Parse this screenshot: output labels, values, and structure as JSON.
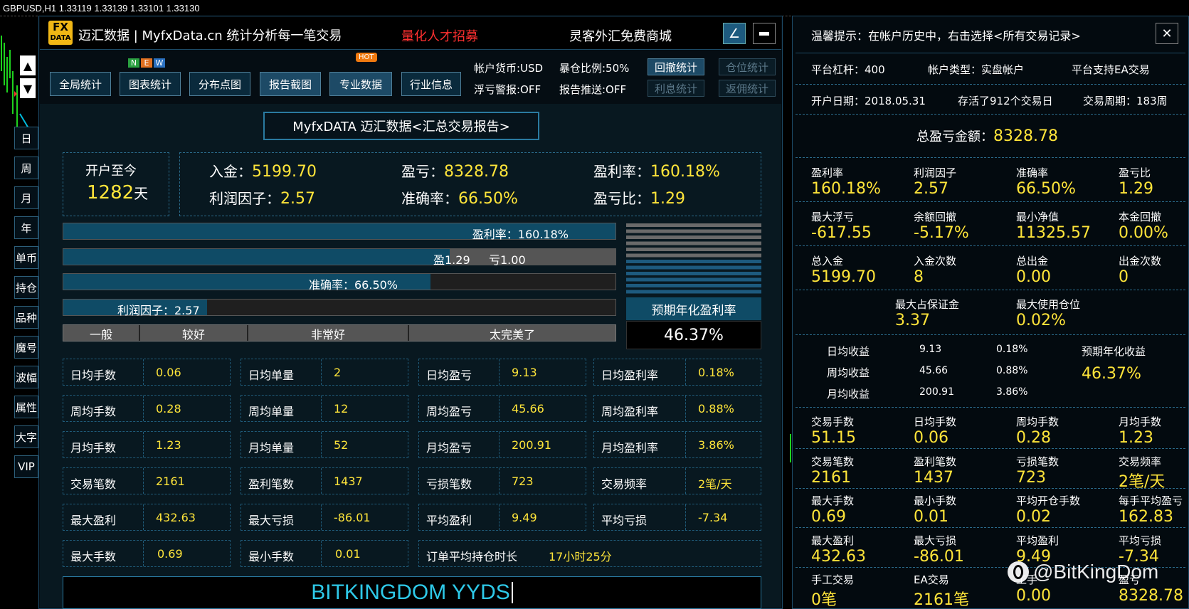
{
  "chart_title": "GBPUSD,H1  1.33119 1.33139 1.33101 1.33130",
  "header": {
    "logo_top": "FX",
    "logo_bottom": "DATA",
    "brand": "迈汇数据 | MyfxData.cn  统计分析每一笔交易",
    "recruit": "量化人才招募",
    "mall": "灵客外汇免费商城",
    "btn_arrow": "∠",
    "btn_min": "▬"
  },
  "toolbar": {
    "tabs": [
      "全局统计",
      "图表统计",
      "分布点图",
      "报告截图",
      "专业数据",
      "行业信息"
    ],
    "new_badge": [
      "N",
      "E",
      "W"
    ],
    "hot_badge": "HOT",
    "account_currency": "帐户货币:USD",
    "position_ratio": "暴仓比例:50%",
    "float_alert": "浮亏警报:OFF",
    "report_push": "报告推送:OFF",
    "right_buttons": [
      "回撤统计",
      "仓位统计",
      "利息统计",
      "返佣统计"
    ]
  },
  "side_buttons": [
    "日",
    "周",
    "月",
    "年",
    "单币",
    "持仓",
    "品种",
    "魔号",
    "波幅",
    "属性",
    "大字",
    "VIP"
  ],
  "report": {
    "title": "MyfxDATA 迈汇数据<汇总交易报告>",
    "since_label": "开户至今",
    "days_value": "1282",
    "days_unit": "天",
    "deposit_label": "入金：",
    "deposit": "5199.70",
    "profit_label": "盈亏：",
    "profit": "8328.78",
    "roi_label": "盈利率：",
    "roi": "160.18%",
    "pf_label": "利润因子：",
    "pf": "2.57",
    "accuracy_label": "准确率：",
    "accuracy": "66.50%",
    "ratio_label": "盈亏比：",
    "ratio": "1.29"
  },
  "bars": {
    "roi_text": "盈利率：160.18%",
    "roi_fill": 1.0,
    "win_text": "盈1.29",
    "loss_text": "亏1.00",
    "win_fill": 0.7,
    "accuracy_text": "准确率：66.50%",
    "accuracy_fill": 0.665,
    "pf_text": "利润因子：2.57",
    "pf_fill": 0.26,
    "scale": [
      "一般",
      "较好",
      "非常好",
      "太完美了"
    ],
    "annual_label": "预期年化盈利率",
    "annual_value": "46.37%"
  },
  "stats": [
    [
      [
        "日均手数",
        "0.06"
      ],
      [
        "日均单量",
        "2"
      ],
      [
        "日均盈亏",
        "9.13"
      ],
      [
        "日均盈利率",
        "0.18%"
      ]
    ],
    [
      [
        "周均手数",
        "0.28"
      ],
      [
        "周均单量",
        "12"
      ],
      [
        "周均盈亏",
        "45.66"
      ],
      [
        "周均盈利率",
        "0.88%"
      ]
    ],
    [
      [
        "月均手数",
        "1.23"
      ],
      [
        "月均单量",
        "52"
      ],
      [
        "月均盈亏",
        "200.91"
      ],
      [
        "月均盈利率",
        "3.86%"
      ]
    ],
    [
      [
        "交易笔数",
        "2161"
      ],
      [
        "盈利笔数",
        "1437"
      ],
      [
        "亏损笔数",
        "723"
      ],
      [
        "交易频率",
        "2笔/天"
      ]
    ],
    [
      [
        "最大盈利",
        "432.63"
      ],
      [
        "最大亏损",
        "-86.01"
      ],
      [
        "平均盈利",
        "9.49"
      ],
      [
        "平均亏损",
        "-7.34"
      ]
    ]
  ],
  "last_row": {
    "max_lots_label": "最大手数",
    "max_lots": "0.69",
    "min_lots_label": "最小手数",
    "min_lots": "0.01",
    "hold_label": "订单平均持仓时长",
    "hold": "17小时25分"
  },
  "footer_banner": "BITKINGDOM YYDS",
  "right": {
    "tip": "温馨提示：在帐户历史中，右击选择<所有交易记录>",
    "close": "✕",
    "leverage": "平台杠杆：400",
    "acct_type": "帐户类型：实盘帐户",
    "ea": "平台支持EA交易",
    "open_date": "开户日期：2018.05.31",
    "survived": "存活了912个交易日",
    "cycle": "交易周期：183周",
    "total_label": "总盈亏金额：",
    "total": "8328.78",
    "grid1": [
      [
        "盈利率",
        "160.18%"
      ],
      [
        "利润因子",
        "2.57"
      ],
      [
        "准确率",
        "66.50%"
      ],
      [
        "盈亏比",
        "1.29"
      ]
    ],
    "grid2": [
      [
        "最大浮亏",
        "-617.55"
      ],
      [
        "余额回撤",
        "-5.17%"
      ],
      [
        "最小净值",
        "11325.57"
      ],
      [
        "本金回撤",
        "0.00%"
      ]
    ],
    "grid3": [
      [
        "总入金",
        "5199.70"
      ],
      [
        "入金次数",
        "8"
      ],
      [
        "总出金",
        "0.00"
      ],
      [
        "出金次数",
        "0"
      ]
    ],
    "grid4": [
      [
        "最大占保证金",
        "3.37"
      ],
      [
        "最大使用仓位",
        "0.02%"
      ]
    ],
    "income": [
      [
        "日均收益",
        "9.13",
        "0.18%"
      ],
      [
        "周均收益",
        "45.66",
        "0.88%"
      ],
      [
        "月均收益",
        "200.91",
        "3.86%"
      ]
    ],
    "annual_label": "预期年化收益",
    "annual": "46.37%",
    "grid5": [
      [
        "交易手数",
        "51.15"
      ],
      [
        "日均手数",
        "0.06"
      ],
      [
        "周均手数",
        "0.28"
      ],
      [
        "月均手数",
        "1.23"
      ]
    ],
    "grid6": [
      [
        "交易笔数",
        "2161"
      ],
      [
        "盈利笔数",
        "1437"
      ],
      [
        "亏损笔数",
        "723"
      ],
      [
        "交易频率",
        "2笔/天"
      ]
    ],
    "grid7": [
      [
        "最大手数",
        "0.69"
      ],
      [
        "最小手数",
        "0.01"
      ],
      [
        "平均开仓手数",
        "0.02"
      ],
      [
        "每手平均盈亏",
        "162.83"
      ]
    ],
    "grid8": [
      [
        "最大盈利",
        "432.63"
      ],
      [
        "最大亏损",
        "-86.01"
      ],
      [
        "平均盈利",
        "9.49"
      ],
      [
        "平均亏损",
        "-7.34"
      ]
    ],
    "grid9": [
      [
        "手工交易",
        "0笔"
      ],
      [
        "EA交易",
        "2161笔"
      ],
      [
        "工手",
        "0.00"
      ],
      [
        "盈亏",
        "8328.78"
      ]
    ]
  },
  "watermark": "@BitKingDom"
}
